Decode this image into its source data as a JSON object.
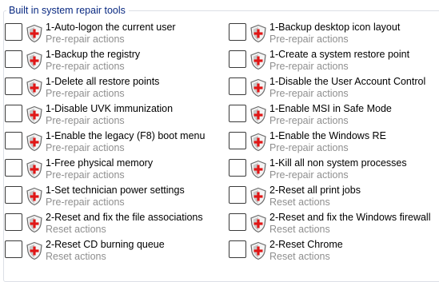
{
  "group": {
    "title": "Built in system repair tools"
  },
  "icon": "shield-icon",
  "left_items": [
    {
      "label": "1-Auto-logon the current user",
      "sub": "Pre-repair actions"
    },
    {
      "label": "1-Backup the registry",
      "sub": "Pre-repair actions"
    },
    {
      "label": "1-Delete all restore points",
      "sub": "Pre-repair actions"
    },
    {
      "label": "1-Disable UVK immunization",
      "sub": "Pre-repair actions"
    },
    {
      "label": "1-Enable the legacy (F8) boot menu",
      "sub": "Pre-repair actions"
    },
    {
      "label": "1-Free physical memory",
      "sub": "Pre-repair actions"
    },
    {
      "label": "1-Set technician power settings",
      "sub": "Pre-repair actions"
    },
    {
      "label": "2-Reset and fix the file associations",
      "sub": "Reset actions"
    },
    {
      "label": "2-Reset CD burning queue",
      "sub": "Reset actions"
    }
  ],
  "right_items": [
    {
      "label": "1-Backup desktop icon layout",
      "sub": "Pre-repair actions"
    },
    {
      "label": "1-Create a system restore point",
      "sub": "Pre-repair actions"
    },
    {
      "label": "1-Disable the User Account Control",
      "sub": "Pre-repair actions"
    },
    {
      "label": "1-Enable MSI in Safe Mode",
      "sub": "Pre-repair actions"
    },
    {
      "label": "1-Enable the Windows RE",
      "sub": "Pre-repair actions"
    },
    {
      "label": "1-Kill all non system processes",
      "sub": "Pre-repair actions"
    },
    {
      "label": "2-Reset all print jobs",
      "sub": "Reset actions"
    },
    {
      "label": "2-Reset and fix the Windows firewall",
      "sub": "Reset actions"
    },
    {
      "label": "2-Reset Chrome",
      "sub": "Reset actions"
    }
  ]
}
